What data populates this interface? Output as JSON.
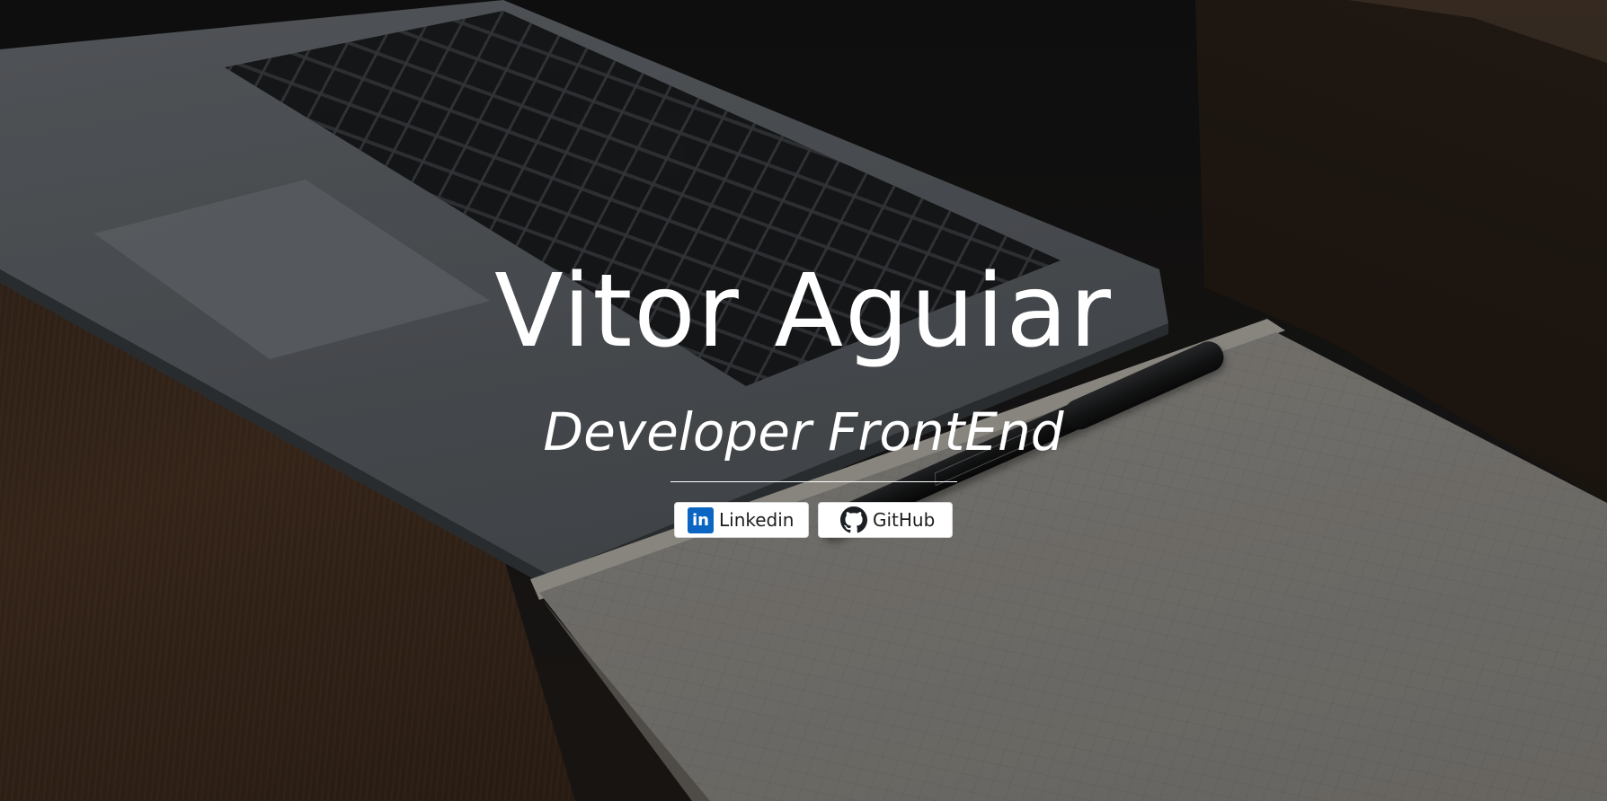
{
  "hero": {
    "name": "Vitor Aguiar",
    "role": "Developer FrontEnd"
  },
  "links": {
    "linkedin": {
      "label": "Linkedin",
      "icon": "linkedin-icon",
      "icon_text": "in",
      "color": "#0a66c2"
    },
    "github": {
      "label": "GitHub",
      "icon": "github-icon",
      "color": "#1b1f23"
    }
  },
  "colors": {
    "text": "#ffffff",
    "button_background": "#ffffff",
    "button_text": "#1d1d1d"
  }
}
